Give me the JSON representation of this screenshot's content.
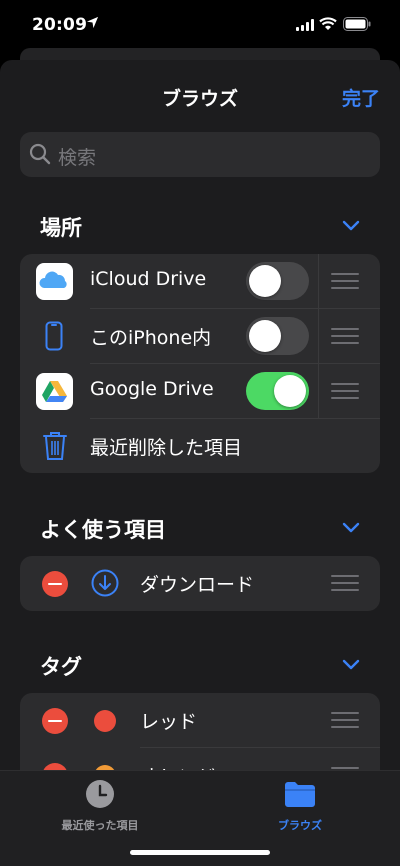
{
  "status_bar": {
    "time": "20:09"
  },
  "sheet": {
    "title": "ブラウズ",
    "done_label": "完了",
    "search_placeholder": "検索"
  },
  "locations": {
    "header": "場所",
    "items": [
      {
        "label": "iCloud Drive",
        "icon": "icloud-icon",
        "toggle": false
      },
      {
        "label": "このiPhone内",
        "icon": "iphone-icon",
        "toggle": false
      },
      {
        "label": "Google Drive",
        "icon": "google-drive-icon",
        "toggle": true
      },
      {
        "label": "最近削除した項目",
        "icon": "trash-icon"
      }
    ]
  },
  "favorites": {
    "header": "よく使う項目",
    "items": [
      {
        "label": "ダウンロード",
        "icon": "download-icon"
      }
    ]
  },
  "tags": {
    "header": "タグ",
    "items": [
      {
        "label": "レッド",
        "color": "#eb4d3d"
      },
      {
        "label": "オレンジ",
        "color": "#f09a37"
      }
    ]
  },
  "tabbar": {
    "recents_label": "最近使った項目",
    "browse_label": "ブラウズ"
  },
  "colors": {
    "accent": "#3b82f6",
    "toggle_on": "#4cd964",
    "destructive": "#eb4d3d"
  }
}
